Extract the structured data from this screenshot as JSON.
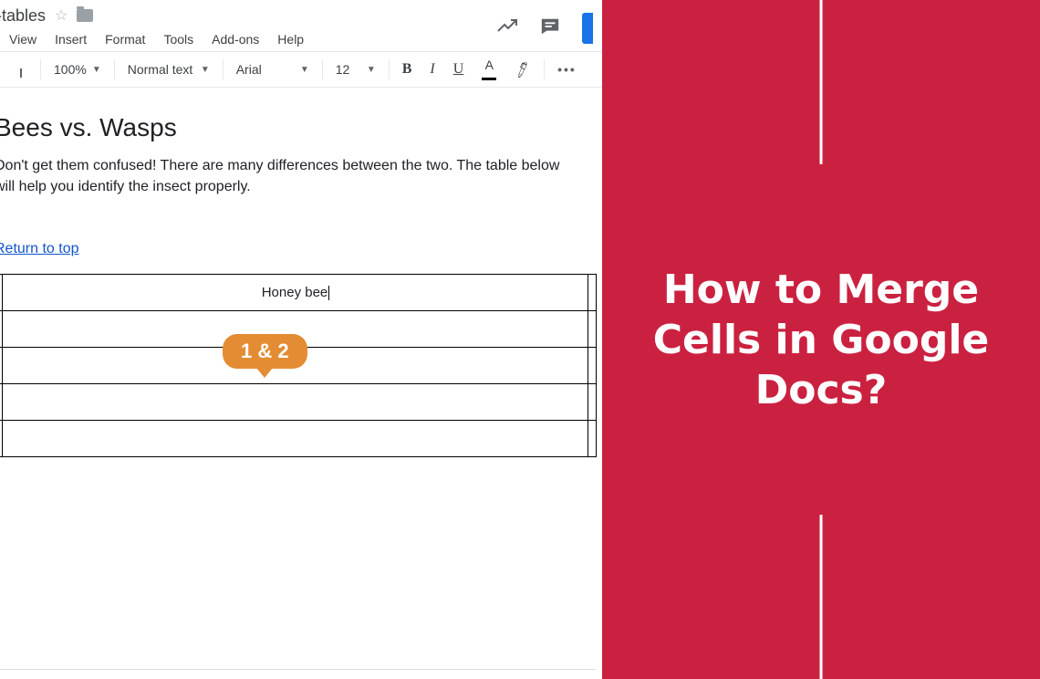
{
  "doc": {
    "title": "-tables",
    "menus": [
      "View",
      "Insert",
      "Format",
      "Tools",
      "Add-ons",
      "Help"
    ]
  },
  "toolbar": {
    "zoom": "100%",
    "style": "Normal text",
    "font": "Arial",
    "size": "12",
    "bold": "B",
    "italic": "I",
    "underline": "U",
    "textcolor": "A",
    "more": "…"
  },
  "content": {
    "heading": "Bees vs. Wasps",
    "para_line1": "Don't get them confused! There are many differences between the two. The table below",
    "para_line2": "will help you identify the insect properly.",
    "link": "Return to top",
    "callout": "1 & 2",
    "table": {
      "rows": 5,
      "cols": 3,
      "r0c1": "Honey bee"
    }
  },
  "overlay": {
    "title": "How to Merge Cells in Google Docs?"
  }
}
